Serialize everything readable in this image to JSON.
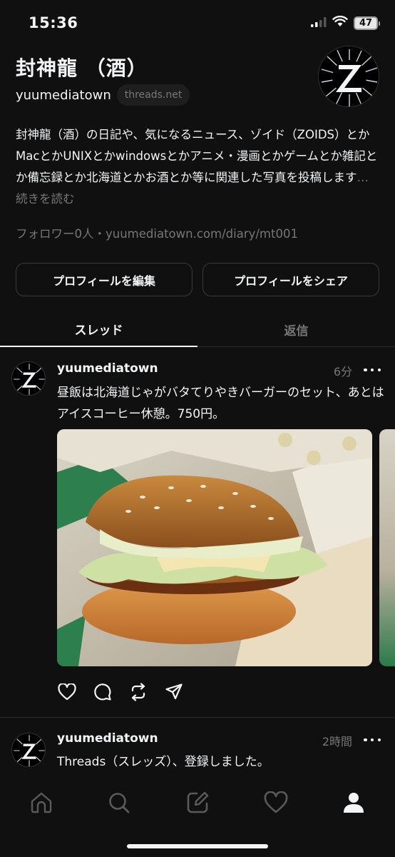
{
  "status_bar": {
    "time": "15:36",
    "battery": "47",
    "icons": [
      "signal-icon",
      "wifi-icon",
      "battery-icon"
    ]
  },
  "profile": {
    "name": "封神龍 （酒）",
    "handle": "yuumediatown",
    "domain_badge": "threads.net",
    "bio": "封神龍（酒）の日記や、気になるニュース、ゾイド（ZOIDS）とかMacとかUNIXとかwindowsとかアニメ・漫画とかゲームとか雑記とか備忘録とか北海道とかお酒とか等に関連した写真を投稿します",
    "bio_more": "… 続きを読む",
    "followers": "フォロワー0人・yuumediatown.com/diary/mt001",
    "edit_button": "プロフィールを編集",
    "share_button": "プロフィールをシェア"
  },
  "tabs": [
    {
      "label": "スレッド",
      "active": true
    },
    {
      "label": "返信",
      "active": false
    }
  ],
  "posts": [
    {
      "username": "yuumediatown",
      "time": "6分",
      "text": "昼飯は北海道じゃがバタてりやきバーガーのセット、あとはアイスコーヒー休憩。750円。"
    },
    {
      "username": "yuumediatown",
      "time": "2時間",
      "text": "Threads（スレッズ）、登録しました。"
    }
  ],
  "post_actions": [
    "heart-icon",
    "comment-icon",
    "repost-icon",
    "share-icon"
  ],
  "bottom_nav": [
    "home-icon",
    "search-icon",
    "compose-icon",
    "activity-icon",
    "profile-icon"
  ],
  "colors": {
    "background": "#101010",
    "text": "#f3f5f7",
    "muted": "#777777",
    "border": "#3a3a3a"
  }
}
